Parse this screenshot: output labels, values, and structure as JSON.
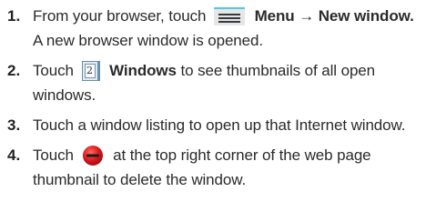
{
  "steps": [
    {
      "number": "1.",
      "parts": {
        "before": "From your browser, touch",
        "menu_icon": "menu-icon",
        "menu_label": "Menu",
        "arrow": "→",
        "target_label": "New window",
        "end": "."
      },
      "result": "A new browser window is opened."
    },
    {
      "number": "2.",
      "parts": {
        "before": "Touch",
        "windows_icon": "windows-icon",
        "windows_count": "2",
        "windows_label": "Windows",
        "after": "to see thumbnails of all open windows."
      }
    },
    {
      "number": "3.",
      "parts": {
        "text": "Touch a window listing to open up that Internet window."
      }
    },
    {
      "number": "4.",
      "parts": {
        "before": "Touch",
        "delete_icon": "delete-icon",
        "after": "at the top right corner of the web page thumbnail to delete the window."
      }
    }
  ],
  "colors": {
    "text": "#2b2b2b",
    "menu_icon_accent": "#55c6e3",
    "delete_icon_red": "#d8141b"
  }
}
